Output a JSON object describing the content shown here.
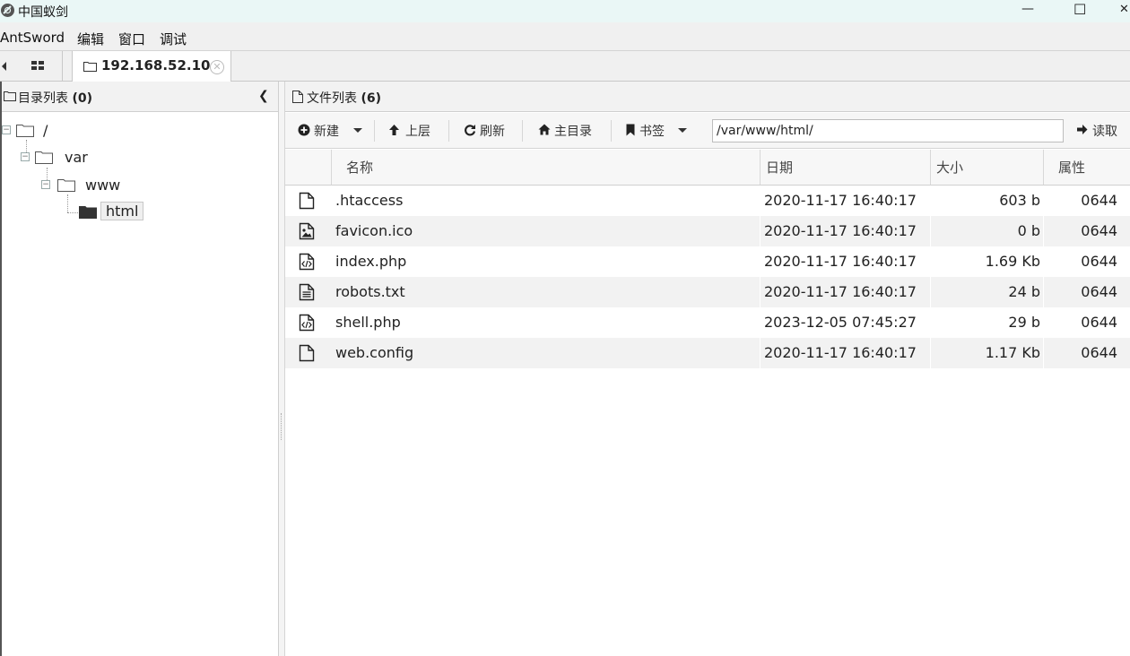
{
  "window": {
    "title": "中国蚁剑",
    "minimize_glyph": "—",
    "maximize_glyph": "☐",
    "close_glyph": "✕"
  },
  "menu": {
    "items": [
      {
        "label": "AntSword"
      },
      {
        "label": "编辑"
      },
      {
        "label": "窗口"
      },
      {
        "label": "调试"
      }
    ]
  },
  "tabs": {
    "host_label": "192.168.52.10",
    "close_glyph": "✕"
  },
  "dir_panel": {
    "title": "目录列表",
    "count": "(0)",
    "collapse_glyph": "❮",
    "tree": [
      {
        "label": "/"
      },
      {
        "label": "var"
      },
      {
        "label": "www"
      },
      {
        "label": "html"
      }
    ]
  },
  "file_panel": {
    "title": "文件列表",
    "count": "(6)",
    "toolbar": {
      "new_label": "新建",
      "up_label": "上层",
      "refresh_label": "刷新",
      "home_label": "主目录",
      "bookmark_label": "书签",
      "path_value": "/var/www/html/",
      "read_label": "读取"
    },
    "columns": {
      "name": "名称",
      "date": "日期",
      "size": "大小",
      "perm": "属性"
    },
    "files": [
      {
        "name": ".htaccess",
        "date": "2020-11-17 16:40:17",
        "size": "603 b",
        "perm": "0644",
        "icon": "file-icon"
      },
      {
        "name": "favicon.ico",
        "date": "2020-11-17 16:40:17",
        "size": "0 b",
        "perm": "0644",
        "icon": "image-file-icon"
      },
      {
        "name": "index.php",
        "date": "2020-11-17 16:40:17",
        "size": "1.69 Kb",
        "perm": "0644",
        "icon": "code-file-icon"
      },
      {
        "name": "robots.txt",
        "date": "2020-11-17 16:40:17",
        "size": "24 b",
        "perm": "0644",
        "icon": "text-file-icon"
      },
      {
        "name": "shell.php",
        "date": "2023-12-05 07:45:27",
        "size": "29 b",
        "perm": "0644",
        "icon": "code-file-icon"
      },
      {
        "name": "web.config",
        "date": "2020-11-17 16:40:17",
        "size": "1.17 Kb",
        "perm": "0644",
        "icon": "file-icon"
      }
    ]
  }
}
